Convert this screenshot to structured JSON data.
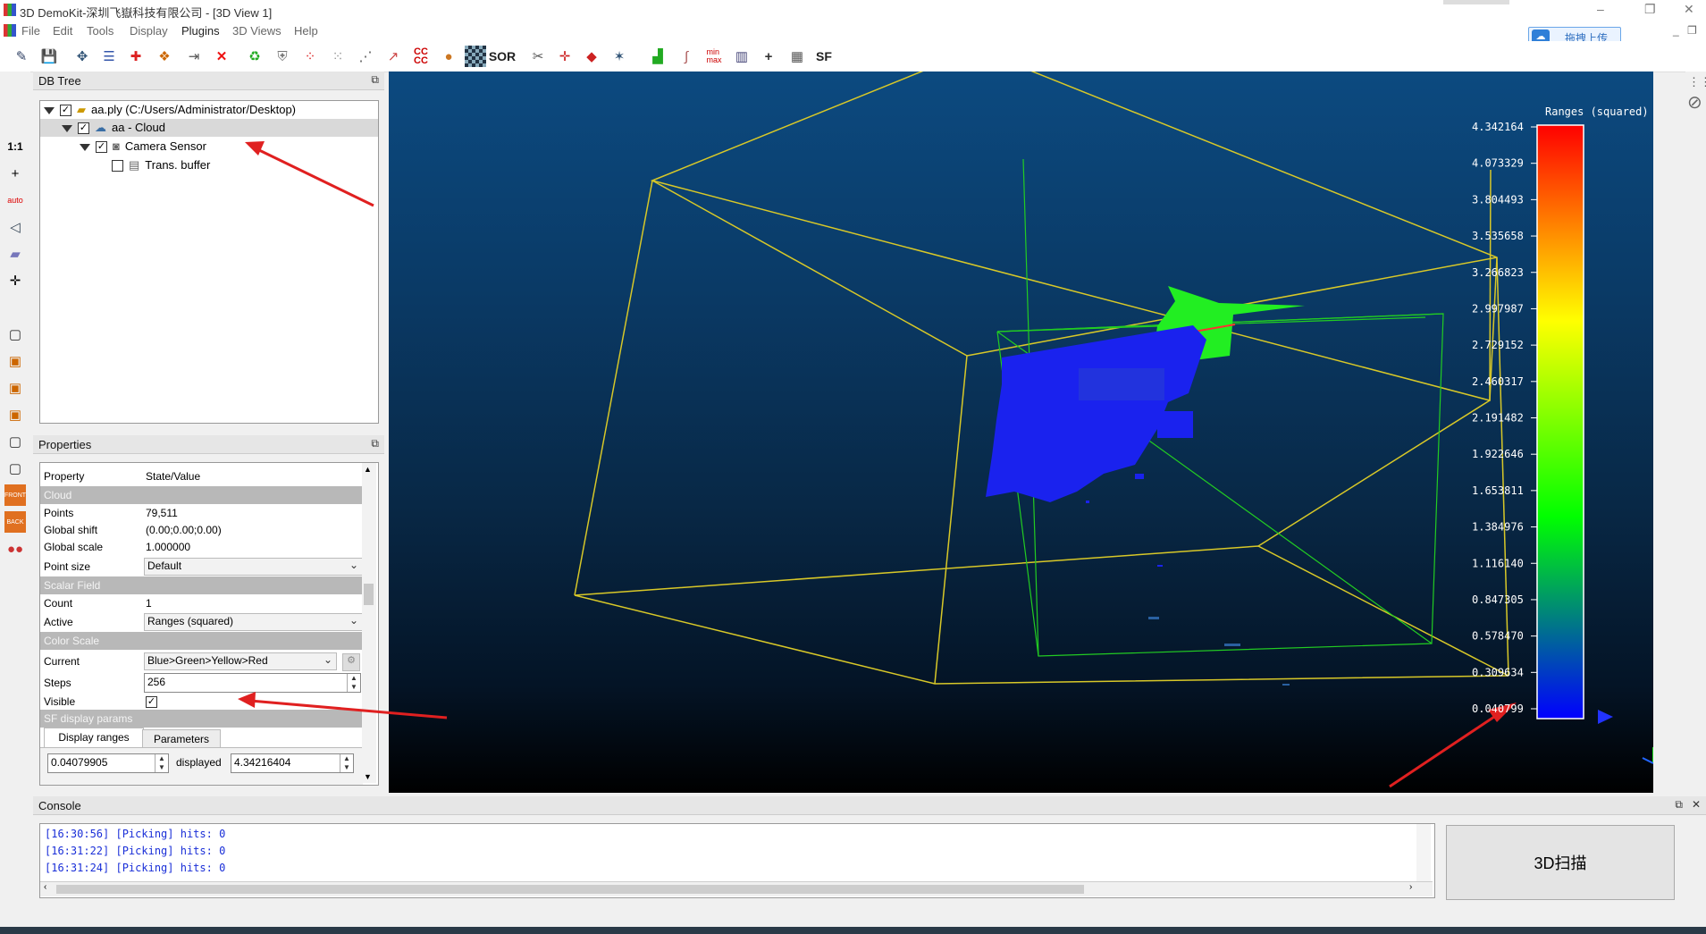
{
  "window": {
    "title": "3D DemoKit-深圳飞嶽科技有限公司 - [3D View 1]",
    "controls": [
      "–",
      "❐",
      "✕"
    ]
  },
  "menu": [
    "File",
    "Edit",
    "Tools",
    "Display",
    "Plugins",
    "3D Views",
    "Help"
  ],
  "upload_button": {
    "label": "拖拽上传"
  },
  "toolbar_text": {
    "sor": "SOR",
    "sf": "SF",
    "ccc": "CC\nCC",
    "minmax": "min\nmax"
  },
  "left_toolbar": {
    "one_to_one": "1:1",
    "auto": "auto",
    "front": "FRONT",
    "back": "BACK"
  },
  "db_tree": {
    "title": "DB Tree",
    "items": [
      {
        "label": "aa.ply (C:/Users/Administrator/Desktop)",
        "checked": true,
        "expanded": true
      },
      {
        "label": "aa - Cloud",
        "checked": true,
        "expanded": true,
        "selected": true
      },
      {
        "label": "Camera Sensor",
        "checked": true,
        "expanded": true
      },
      {
        "label": "Trans. buffer",
        "checked": false
      }
    ]
  },
  "properties": {
    "title": "Properties",
    "header": {
      "property": "Property",
      "value": "State/Value"
    },
    "sections": {
      "cloud": "Cloud",
      "scalar_field": "Scalar Field",
      "color_scale": "Color Scale",
      "sf_display": "SF display params"
    },
    "rows": {
      "points": {
        "k": "Points",
        "v": "79,511"
      },
      "global_shift": {
        "k": "Global shift",
        "v": "(0.00;0.00;0.00)"
      },
      "global_scale": {
        "k": "Global scale",
        "v": "1.000000"
      },
      "point_size": {
        "k": "Point size",
        "v": "Default"
      },
      "count": {
        "k": "Count",
        "v": "1"
      },
      "active": {
        "k": "Active",
        "v": "Ranges (squared)"
      },
      "current": {
        "k": "Current",
        "v": "Blue>Green>Yellow>Red"
      },
      "steps": {
        "k": "Steps",
        "v": "256"
      },
      "visible": {
        "k": "Visible",
        "v": true
      }
    },
    "tabs": [
      "Display ranges",
      "Parameters"
    ],
    "range_min": "0.04079905",
    "displayed_label": "displayed",
    "range_max": "4.34216404"
  },
  "scale_bar": {
    "title": "Ranges (squared)",
    "ticks": [
      "4.342164",
      "4.073329",
      "3.804493",
      "3.535658",
      "3.266823",
      "2.997987",
      "2.729152",
      "2.460317",
      "2.191482",
      "1.922646",
      "1.653811",
      "1.384976",
      "1.116140",
      "0.847305",
      "0.578470",
      "0.309634",
      "0.040799"
    ],
    "colors": [
      "#ff0000",
      "#ffff00",
      "#00ff00",
      "#0000ff"
    ]
  },
  "console": {
    "title": "Console",
    "lines": [
      "[16:30:56] [Picking] hits: 0",
      "[16:31:22] [Picking] hits: 0",
      "[16:31:24] [Picking] hits: 0"
    ]
  },
  "scan_button": {
    "label": "3D扫描"
  }
}
